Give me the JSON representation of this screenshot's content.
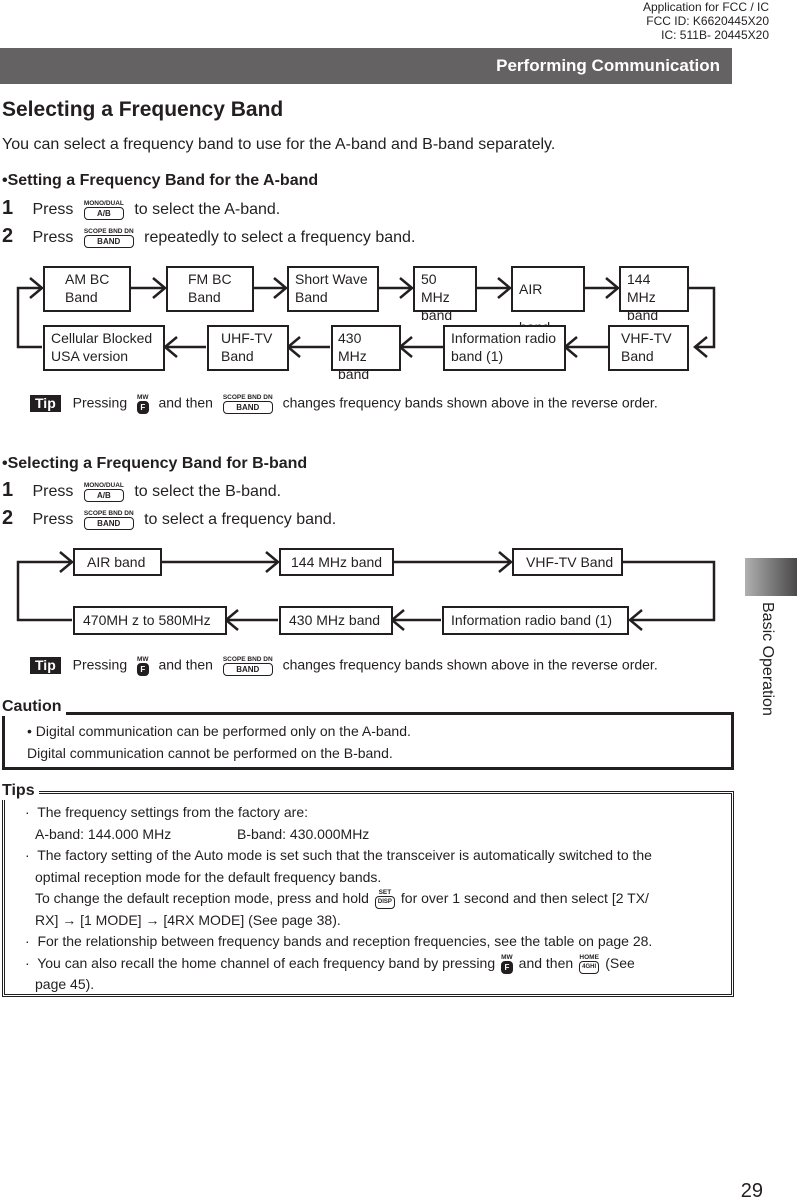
{
  "fcc_notice": [
    "Application for FCC / IC",
    "FCC ID: K6620445X20",
    "IC: 511B- 20445X20"
  ],
  "header": {
    "title": "Performing Communication"
  },
  "section": {
    "title": "Selecting a Frequency Band",
    "intro": "You can select a frequency band to use for the A-band and B-band separately."
  },
  "a_band": {
    "heading": "•Setting a Frequency Band for the A-band",
    "steps": [
      {
        "num": "1",
        "pre": "Press",
        "key_cap": "MONO/DUAL",
        "key": "A/B",
        "post": "to select the A-band."
      },
      {
        "num": "2",
        "pre": "Press",
        "key_cap": "SCOPE  BND DN",
        "key": "BAND",
        "post": "repeatedly to select a frequency band."
      }
    ],
    "flow": {
      "row1": [
        {
          "l1": "AM BC",
          "l2": "Band"
        },
        {
          "l1": "FM BC",
          "l2": "Band"
        },
        {
          "l1": "Short Wave",
          "l2": "Band"
        },
        {
          "l1": "50 MHz",
          "l2": "band"
        },
        {
          "l1": "AIR band",
          "l2": ""
        },
        {
          "l1": "144 MHz",
          "l2": "band"
        }
      ],
      "row2": [
        {
          "l1": "Cellular Blocked",
          "l2": "USA version"
        },
        {
          "l1": "UHF-TV",
          "l2": "Band"
        },
        {
          "l1": "430 MHz",
          "l2": "band"
        },
        {
          "l1": "Information radio",
          "l2": "band (1)"
        },
        {
          "l1": "VHF-TV",
          "l2": "Band"
        }
      ]
    },
    "tip": {
      "badge": "Tip",
      "pre": "Pressing",
      "key1_cap": "MW",
      "key1": "F",
      "mid": "and then",
      "key2_cap": "SCOPE  BND DN",
      "key2": "BAND",
      "post": "changes frequency bands shown above in the reverse order."
    }
  },
  "b_band": {
    "heading": "•Selecting a Frequency Band for B-band",
    "steps": [
      {
        "num": "1",
        "pre": "Press",
        "key_cap": "MONO/DUAL",
        "key": "A/B",
        "post": "to select the B-band."
      },
      {
        "num": "2",
        "pre": "Press",
        "key_cap": "SCOPE  BND DN",
        "key": "BAND",
        "post": "to select a frequency band."
      }
    ],
    "flow": {
      "row1": [
        "AIR band",
        "144 MHz band",
        "VHF-TV Band"
      ],
      "row2": [
        "470MH z  to 580MHz",
        "430 MHz band",
        "Information radio band (1)"
      ]
    },
    "tip": {
      "badge": "Tip",
      "pre": "Pressing",
      "key1_cap": "MW",
      "key1": "F",
      "mid": "and then",
      "key2_cap": "SCOPE  BND DN",
      "key2": "BAND",
      "post": "changes frequency bands shown above in the reverse order."
    }
  },
  "caution": {
    "label": "Caution",
    "line1": "• Digital communication can be performed only on the A-band.",
    "line2": "Digital communication cannot be performed on the B-band."
  },
  "tips": {
    "label": "Tips",
    "t1_a": "The frequency settings from the factory are:",
    "t1_b1": "A-band: 144.000 MHz",
    "t1_b2": "B-band: 430.000MHz",
    "t2_a": "The factory setting of the Auto mode is set such that the transceiver is automatically switched to the",
    "t2_b": "optimal reception mode for the default frequency bands.",
    "t2_c_pre": "To change the default reception mode, press and hold",
    "t2_key_cap": "SET",
    "t2_key": "DISP",
    "t2_c_post": "for over 1 second and then select [2 TX/",
    "t2_d": "RX] → [1 MODE] → [4RX MODE] (See page 38).",
    "t3": "For the relationship between frequency bands and reception frequencies, see the table on page 28.",
    "t4_pre": "You can also recall the home channel of each frequency band by pressing",
    "t4_key1_cap": "MW",
    "t4_key1": "F",
    "t4_mid": "and then",
    "t4_key2_cap": "HOME",
    "t4_key2": "4GHI",
    "t4_post": "(See",
    "t4_b": "page 45).",
    "bullet": "·"
  },
  "side_tab": {
    "label": "Basic Operation"
  },
  "page_number": "29"
}
